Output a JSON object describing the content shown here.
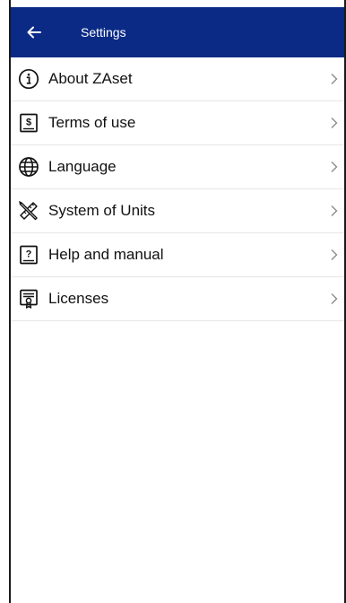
{
  "appbar": {
    "title": "Settings",
    "back_icon": "arrow-left-icon",
    "background": "#0a2a86"
  },
  "menu": {
    "items": [
      {
        "label": "About ZAset",
        "icon": "info-circle-icon"
      },
      {
        "label": "Terms of use",
        "icon": "document-dollar-icon"
      },
      {
        "label": "Language",
        "icon": "globe-icon"
      },
      {
        "label": "System of Units",
        "icon": "ruler-pencil-icon"
      },
      {
        "label": "Help and manual",
        "icon": "help-book-icon"
      },
      {
        "label": "Licenses",
        "icon": "certificate-icon"
      }
    ],
    "chevron_icon": "chevron-right-icon"
  }
}
